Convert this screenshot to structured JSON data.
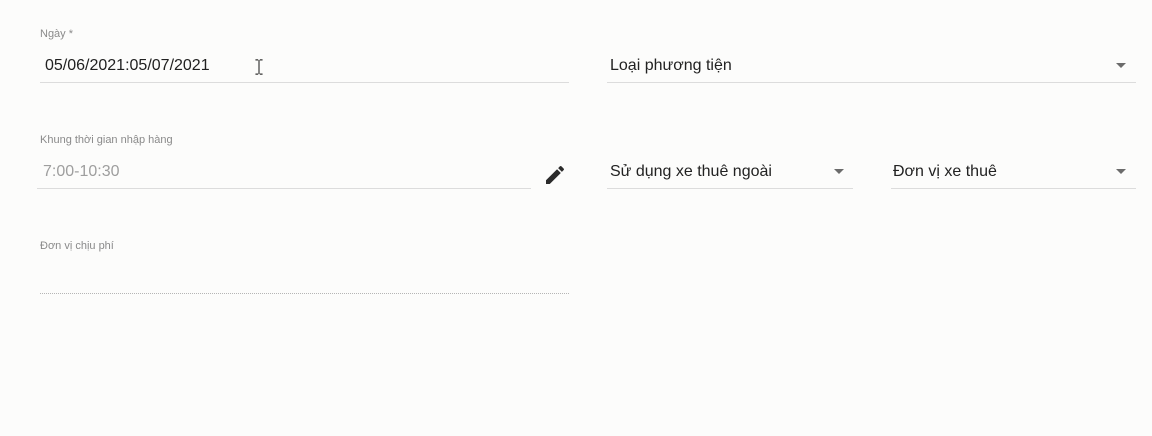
{
  "form": {
    "date": {
      "label": "Ngày *",
      "value": "05/06/2021:05/07/2021"
    },
    "vehicle_type": {
      "placeholder": "Loại phương tiện"
    },
    "time_slot": {
      "label": "Khung thời gian nhập hàng",
      "value": "7:00-10:30",
      "edit_icon": "pencil-icon"
    },
    "outsourced_vehicle": {
      "placeholder": "Sử dụng xe thuê ngoài"
    },
    "rental_unit": {
      "placeholder": "Đơn vị xe thuê"
    },
    "cost_unit": {
      "label": "Đơn vị chịu phí",
      "value": ""
    }
  },
  "colors": {
    "background": "#fcfcfb",
    "label": "#8a8a8a",
    "underline": "#dcdcdc",
    "disabled_text": "#9e9e9e",
    "arrow": "#6b6b6b"
  }
}
